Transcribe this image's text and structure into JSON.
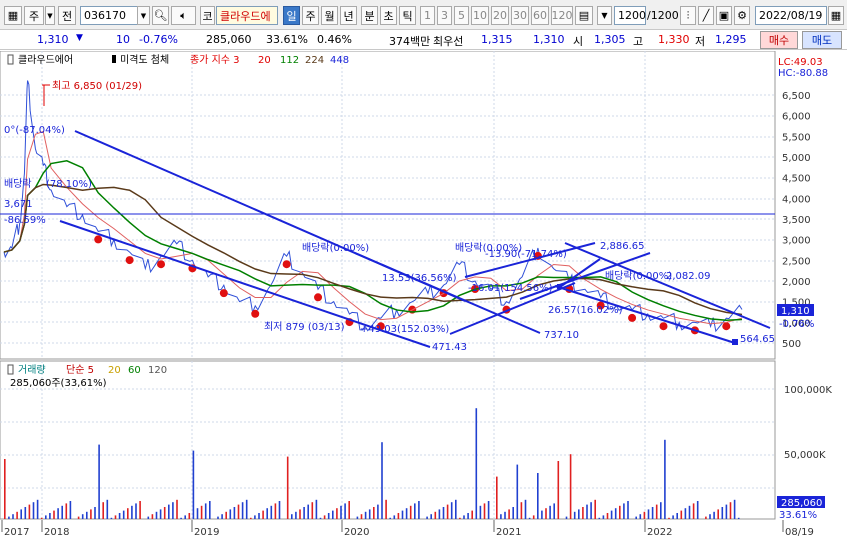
{
  "toolbar": {
    "type1": "주",
    "type2": "전",
    "code": "036170",
    "name_prefix": "코",
    "stock_name": "클라우드에",
    "periods": [
      "일",
      "주",
      "월",
      "년",
      "분",
      "초",
      "틱"
    ],
    "active_period": "일",
    "intervals": [
      "1",
      "3",
      "5",
      "10",
      "20",
      "30",
      "60",
      "120"
    ],
    "count": "1200",
    "count_total": "/1200",
    "date": "2022/08/19"
  },
  "quote": {
    "price": "1,310",
    "change": "10",
    "change_pct": "-0.76%",
    "volume": "285,060",
    "vol_ratio": "33.61%",
    "turnover": "0.46%",
    "amount": "374백만",
    "best_ask_label": "최우선",
    "best_ask": "1,315",
    "best_bid": "1,310",
    "open_label": "시",
    "open": "1,305",
    "high_label": "고",
    "high": "1,330",
    "low_label": "저",
    "low": "1,295",
    "buy_label": "매수",
    "sell_label": "매도"
  },
  "price_legend": {
    "name": "클라우드에어",
    "ind1": "미격도 첨체",
    "ma_label": "종가 지수 3",
    "ma_values": [
      "20",
      "112",
      "224",
      "448"
    ]
  },
  "vol_legend": {
    "name": "거래량",
    "ma_label": "단순 5",
    "ma_values": [
      "20",
      "60",
      "120"
    ],
    "current": "285,060주(33,61%)"
  },
  "annotations": {
    "high": "최고 6,850 (01/29)",
    "low": "최저 879 (03/13)",
    "low_change": "+49.03(152.03%)",
    "level_line": "3,671",
    "zero_pct": "0°(-87.04%)",
    "left_pct": "-86.59%",
    "div1": "배당락",
    "div1_pct": "(78.10%)",
    "div2": "배당락(0.00%)",
    "div3": "배당락(0.00%)",
    "div4": "배당락(0.00%)",
    "t1": "13.53(36.56%)",
    "t2": "-16.01(154.56%)",
    "t3": "-13.90(-71.74%)",
    "t4": "26.57(16.02%)",
    "p1": "471.43",
    "p2": "737.10",
    "p3": "2,886.65",
    "p4": "2,082.09",
    "p5": "564.65",
    "lc": "LC:49.03",
    "hc": "HC:-80.88",
    "cur_price": "1,310",
    "cur_pct": "-0.76%",
    "vol_cur": "285,060",
    "vol_pct": "33.61%"
  },
  "chart_data": {
    "type": "line",
    "price_axis": [
      500,
      1000,
      1500,
      2000,
      2500,
      3000,
      3500,
      4000,
      4500,
      5000,
      5500,
      6000,
      6500
    ],
    "price_axis_labels": [
      "500",
      "1,000",
      "1,500",
      "2,000",
      "2,500",
      "3,000",
      "3,500",
      "4,000",
      "4,500",
      "5,000",
      "5,500",
      "6,000",
      "6,500"
    ],
    "volume_axis": [
      50000,
      100000
    ],
    "volume_axis_labels": [
      "50,000K",
      "100,000K"
    ],
    "x_labels": [
      "2017",
      "2018",
      "2019",
      "2020",
      "2021",
      "2022",
      "08/19"
    ],
    "price_series": [
      [
        0,
        2700
      ],
      [
        0.5,
        2800
      ],
      [
        1,
        3400
      ],
      [
        1.3,
        4600
      ],
      [
        1.5,
        6850
      ],
      [
        2,
        5200
      ],
      [
        2.5,
        4800
      ],
      [
        3,
        4200
      ],
      [
        4,
        3800
      ],
      [
        5,
        3600
      ],
      [
        6,
        3200
      ],
      [
        7,
        3000
      ],
      [
        8,
        2700
      ],
      [
        9,
        2300
      ],
      [
        10,
        2600
      ],
      [
        11,
        2900
      ],
      [
        12,
        2500
      ],
      [
        13,
        2100
      ],
      [
        14,
        1900
      ],
      [
        15,
        1500
      ],
      [
        16,
        1400
      ],
      [
        17,
        1900
      ],
      [
        18,
        2600
      ],
      [
        19,
        2200
      ],
      [
        20,
        1800
      ],
      [
        21,
        1500
      ],
      [
        22,
        1200
      ],
      [
        23,
        900
      ],
      [
        24,
        1100
      ],
      [
        25,
        1300
      ],
      [
        26,
        1500
      ],
      [
        27,
        1700
      ],
      [
        28,
        1900
      ],
      [
        29,
        2400
      ],
      [
        30,
        2000
      ],
      [
        31,
        1800
      ],
      [
        32,
        1500
      ],
      [
        33,
        2100
      ],
      [
        34,
        2800
      ],
      [
        35,
        2300
      ],
      [
        36,
        2000
      ],
      [
        37,
        1800
      ],
      [
        38,
        1600
      ],
      [
        39,
        1400
      ],
      [
        40,
        1300
      ],
      [
        41,
        1200
      ],
      [
        42,
        1100
      ],
      [
        43,
        1000
      ],
      [
        44,
        1000
      ],
      [
        45,
        900
      ],
      [
        46,
        1100
      ],
      [
        47,
        1310
      ]
    ]
  }
}
